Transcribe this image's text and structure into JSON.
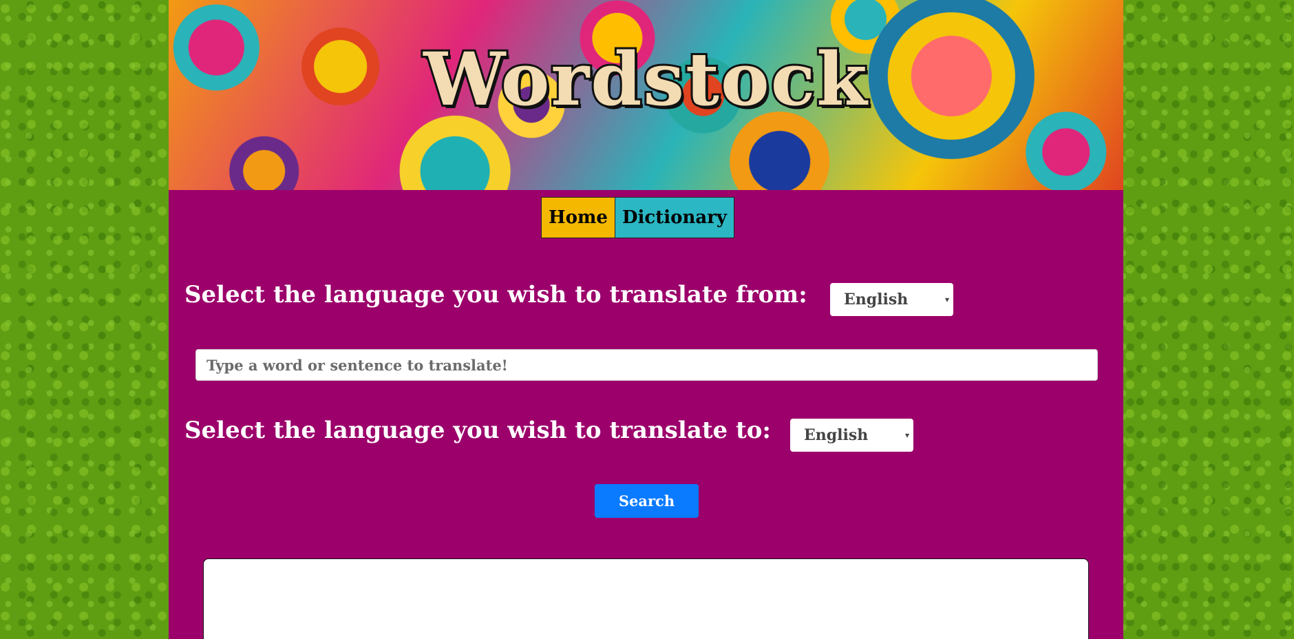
{
  "header": {
    "title": "Wordstock"
  },
  "nav": {
    "items": [
      {
        "label": "Home"
      },
      {
        "label": "Dictionary"
      }
    ]
  },
  "translator": {
    "from_label": "Select the language you wish to translate from:",
    "from_value": "English",
    "input_placeholder": "Type a word or sentence to translate!",
    "to_label": "Select the language you wish to translate to:",
    "to_value": "English",
    "search_label": "Search",
    "caret_icon": "▾"
  },
  "output": {
    "text": ""
  },
  "colors": {
    "page_bg": "#9c006b",
    "body_bg": "#5f9e12",
    "home_tab": "#f5b800",
    "dictionary_tab": "#2bb7c4",
    "search_button": "#0a7bff",
    "title_fill": "#f3dcb3"
  }
}
